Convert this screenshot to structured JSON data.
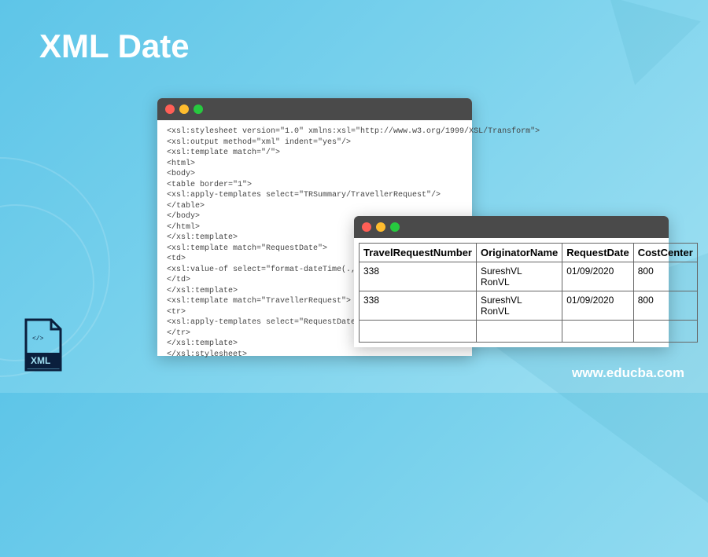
{
  "title": "XML Date",
  "website": "www.educba.com",
  "xml_badge_label": "XML",
  "code": "<xsl:stylesheet version=\"1.0\" xmlns:xsl=\"http://www.w3.org/1999/XSL/Transform\">\n<xsl:output method=\"xml\" indent=\"yes\"/>\n<xsl:template match=\"/\">\n<html>\n<body>\n<table border=\"1\">\n<xsl:apply-templates select=\"TRSummary/TravellerRequest\"/>\n</table>\n</body>\n</html>\n</xsl:template>\n<xsl:template match=\"RequestDate\">\n<td>\n<xsl:value-of select=\"format-dateTime(.,'[M\n</td>\n</xsl:template>\n<xsl:template match=\"TravellerRequest\">\n<tr>\n<xsl:apply-templates select=\"RequestDate\"/\n</tr>\n</xsl:template>\n</xsl:stylesheet>",
  "table": {
    "headers": [
      "TravelRequestNumber",
      "OriginatorName",
      "RequestDate",
      "CostCenter"
    ],
    "rows": [
      {
        "cells": [
          "338",
          "SureshVL\nRonVL",
          "01/09/2020",
          "800"
        ]
      },
      {
        "cells": [
          "338",
          "SureshVL\nRonVL",
          "01/09/2020",
          "800"
        ]
      },
      {
        "cells": [
          "",
          "",
          "",
          ""
        ]
      }
    ]
  }
}
